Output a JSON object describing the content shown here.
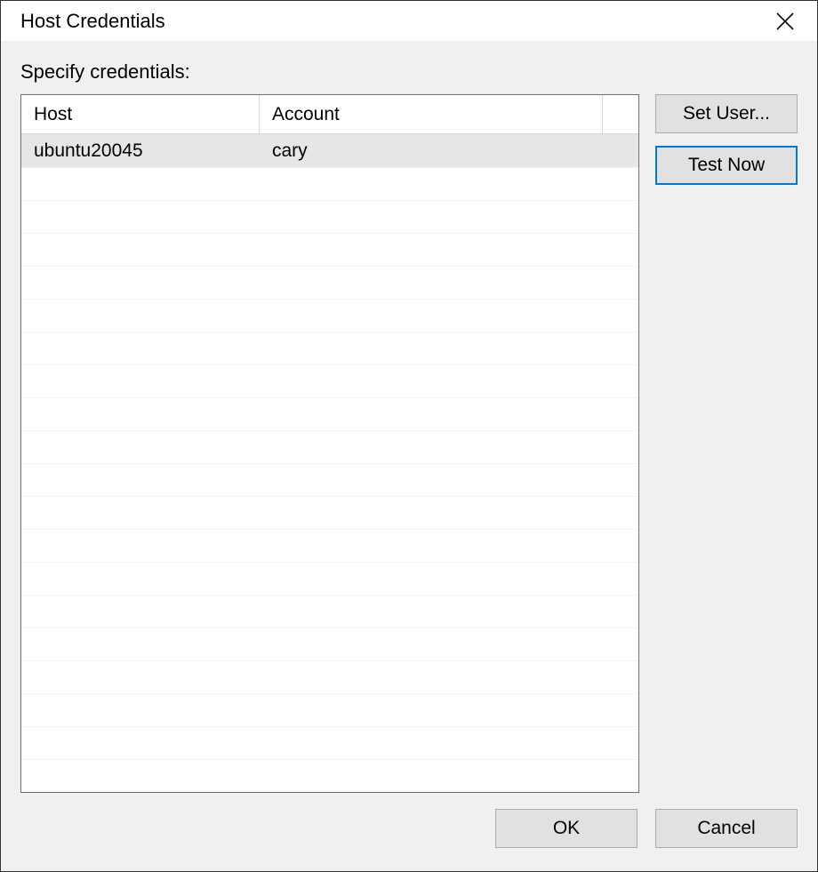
{
  "title": "Host Credentials",
  "specify_label": "Specify credentials:",
  "table": {
    "columns": {
      "host": "Host",
      "account": "Account"
    },
    "rows": [
      {
        "host": "ubuntu20045",
        "account": "cary",
        "selected": true
      }
    ]
  },
  "buttons": {
    "set_user": "Set User...",
    "test_now": "Test Now",
    "ok": "OK",
    "cancel": "Cancel"
  }
}
